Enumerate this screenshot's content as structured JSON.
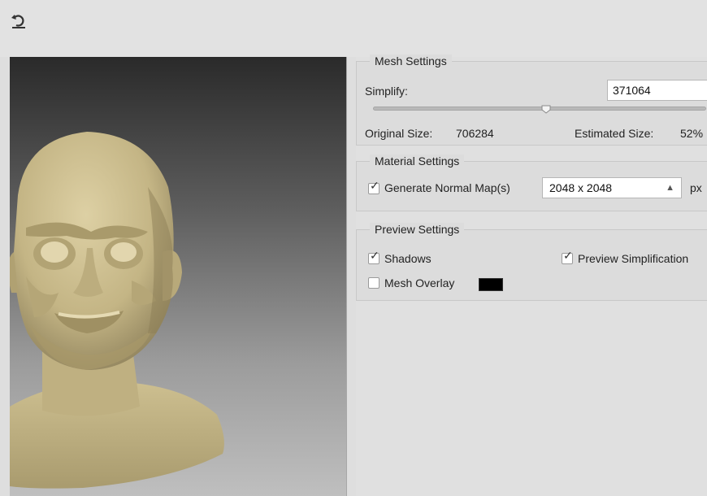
{
  "toolbar": {
    "undo_icon": "undo-icon"
  },
  "mesh_settings": {
    "title": "Mesh Settings",
    "simplify_label": "Simplify:",
    "simplify_value": "371064",
    "slider_fraction": 0.52,
    "original_size_label": "Original Size:",
    "original_size_value": "706284",
    "estimated_size_label": "Estimated Size:",
    "estimated_size_value": "52%"
  },
  "material_settings": {
    "title": "Material Settings",
    "generate_normal_maps_label": "Generate Normal Map(s)",
    "generate_normal_maps_checked": true,
    "map_size_value": "2048 x 2048",
    "map_size_unit": "px"
  },
  "preview_settings": {
    "title": "Preview Settings",
    "shadows_label": "Shadows",
    "shadows_checked": true,
    "preview_simplification_label": "Preview Simplification",
    "preview_simplification_checked": true,
    "mesh_overlay_label": "Mesh Overlay",
    "mesh_overlay_checked": false,
    "mesh_overlay_color": "#000000"
  },
  "colors": {
    "model": "#cbbd8f",
    "panel_bg": "#dcdcdc"
  }
}
